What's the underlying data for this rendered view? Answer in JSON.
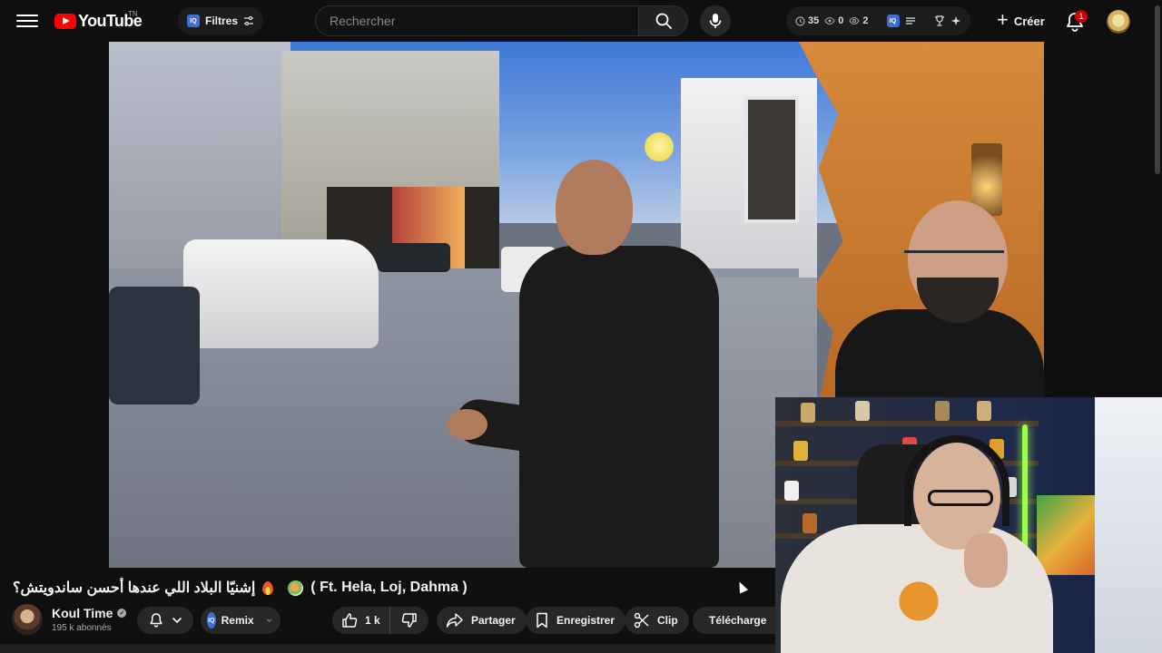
{
  "header": {
    "logo_text": "YouTube",
    "logo_country": "TN",
    "filters_iq": "IQ",
    "filters_label": "Filtres",
    "search_placeholder": "Rechercher",
    "stats": {
      "history": "35",
      "views": "0",
      "watched": "2"
    },
    "stats_iq": "IQ",
    "create_label": "Créer",
    "notification_count": "1",
    "brand_color": "#ff0000",
    "accent_color": "#3b6fd8"
  },
  "video": {
    "title_rtl": "إشنيّا البلاد اللي عندها أحسن ساندويتش؟",
    "title_ltr": "( Ft. Hela, Loj, Dahma )",
    "title_emojis": [
      "fire-emoji",
      "food-emoji"
    ]
  },
  "channel": {
    "name": "Koul Time",
    "subscribers": "195 k abonnés"
  },
  "actions": {
    "remix_iq": "IQ",
    "remix_label": "Remix",
    "like_count": "1 k",
    "share_label": "Partager",
    "save_label": "Enregistrer",
    "clip_label": "Clip",
    "download_label": "Télécharge"
  }
}
